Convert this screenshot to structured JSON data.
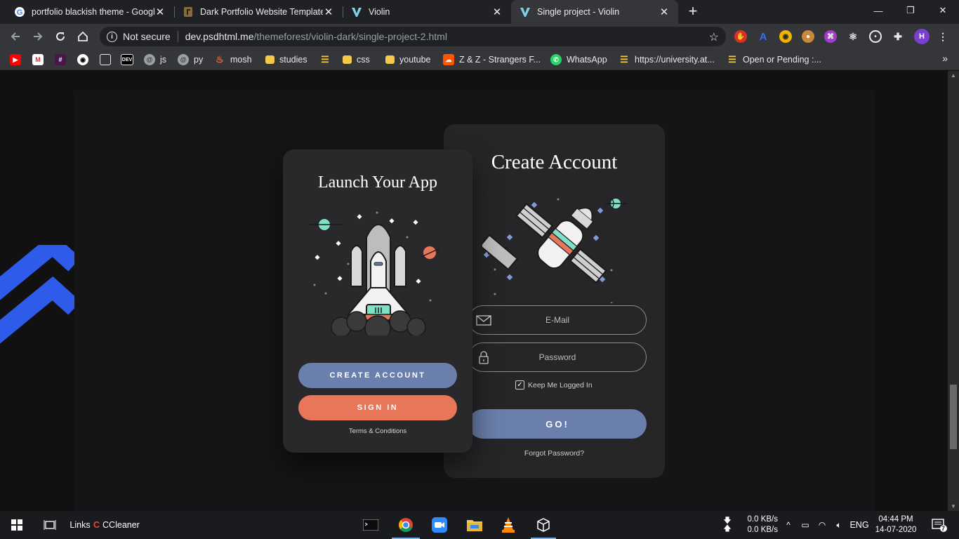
{
  "browser": {
    "tabs": [
      {
        "title": "portfolio blackish theme - Google",
        "icon": "google-g-icon",
        "active": false
      },
      {
        "title": "Dark Portfolio Website Templates",
        "icon": "themeforest-leaf-icon",
        "active": false
      },
      {
        "title": "Violin",
        "icon": "violin-v-icon",
        "active": false
      },
      {
        "title": "Single project - Violin",
        "icon": "violin-v-icon",
        "active": true
      }
    ],
    "new_tab_label": "+",
    "window_controls": {
      "minimize": "—",
      "maximize": "❐",
      "close": "✕"
    },
    "omnibox": {
      "security_label": "Not secure",
      "host": "dev.psdhtml.me",
      "path": "/themeforest/violin-dark/single-project-2.html"
    },
    "profile_initial": "H",
    "bookmarks": [
      {
        "label": "",
        "icon": "youtube-icon"
      },
      {
        "label": "",
        "icon": "gmail-icon"
      },
      {
        "label": "",
        "icon": "slack-icon"
      },
      {
        "label": "",
        "icon": "github-icon"
      },
      {
        "label": "",
        "icon": "codesandbox-icon"
      },
      {
        "label": "",
        "icon": "dev-icon",
        "badge": "DEV"
      },
      {
        "label": "js",
        "icon": "spiral-icon"
      },
      {
        "label": "py",
        "icon": "spiral-icon"
      },
      {
        "label": "mosh",
        "icon": "codewithmosh-icon"
      },
      {
        "label": "studies",
        "icon": "folder-icon"
      },
      {
        "label": "",
        "icon": "ladder-icon"
      },
      {
        "label": "css",
        "icon": "folder-icon"
      },
      {
        "label": "youtube",
        "icon": "folder-icon"
      },
      {
        "label": "Z & Z - Strangers F...",
        "icon": "soundcloud-icon"
      },
      {
        "label": "WhatsApp",
        "icon": "whatsapp-icon"
      },
      {
        "label": "https://university.at...",
        "icon": "ladder-icon"
      },
      {
        "label": "Open or Pending :...",
        "icon": "ladder-icon"
      }
    ],
    "bookmarks_more": "»"
  },
  "page": {
    "launch_card": {
      "title": "Launch Your App",
      "create_account_button": "CREATE ACCOUNT",
      "sign_in_button": "SIGN IN",
      "terms_link": "Terms & Conditions"
    },
    "create_card": {
      "title": "Create Account",
      "email_placeholder": "E-Mail",
      "password_placeholder": "Password",
      "keep_logged_in": "Keep Me Logged In",
      "keep_logged_in_checked": true,
      "go_button": "GO!",
      "forgot_link": "Forgot Password?"
    },
    "colors": {
      "accent_blue": "#6b7fad",
      "accent_orange": "#e8775a",
      "zigzag_blue": "#2f5bea"
    }
  },
  "taskbar": {
    "links_label": "Links",
    "ccleaner_label": "CCleaner",
    "network": {
      "down": "0.0 KB/s",
      "up": "0.0 KB/s"
    },
    "language": "ENG",
    "time": "04:44 PM",
    "date": "14-07-2020",
    "notification_count": "7"
  }
}
